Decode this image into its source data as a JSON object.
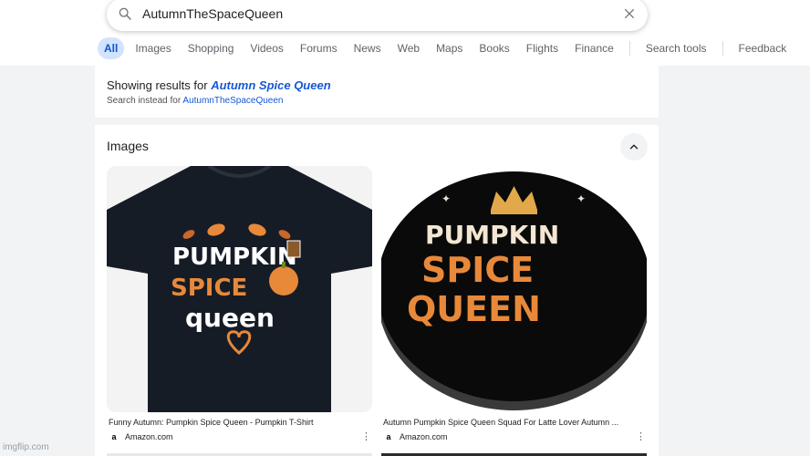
{
  "search": {
    "query": "AutumnTheSpaceQueen"
  },
  "tabs": [
    {
      "label": "All",
      "active": true
    },
    {
      "label": "Images"
    },
    {
      "label": "Shopping"
    },
    {
      "label": "Videos"
    },
    {
      "label": "Forums"
    },
    {
      "label": "News"
    },
    {
      "label": "Web"
    },
    {
      "label": "Maps"
    },
    {
      "label": "Books"
    },
    {
      "label": "Flights"
    },
    {
      "label": "Finance"
    }
  ],
  "tools": {
    "search_tools": "Search tools",
    "feedback": "Feedback"
  },
  "correction": {
    "prefix": "Showing results for",
    "corrected_query": "Autumn Spice Queen",
    "instead_prefix": "Search instead for",
    "original_query": "AutumnTheSpaceQueen"
  },
  "images_section": {
    "heading": "Images",
    "results": [
      {
        "title": "Funny Autumn: Pumpkin Spice Queen - Pumpkin T-Shirt",
        "source": "Amazon.com",
        "favicon": "a",
        "shirt_lines": [
          "PUMPKIN",
          "SPICE",
          "queen"
        ]
      },
      {
        "title": "Autumn Pumpkin Spice Queen Squad For Latte Lover Autumn ...",
        "source": "Amazon.com",
        "favicon": "a",
        "badge_lines": [
          "PUMPKIN",
          "SPICE",
          "QUEEN"
        ]
      }
    ]
  },
  "watermark": "imgflip.com",
  "colors": {
    "accent": "#1558d6",
    "active_tab_bg": "#d3e3fd",
    "pumpkin_orange": "#e8893a"
  }
}
